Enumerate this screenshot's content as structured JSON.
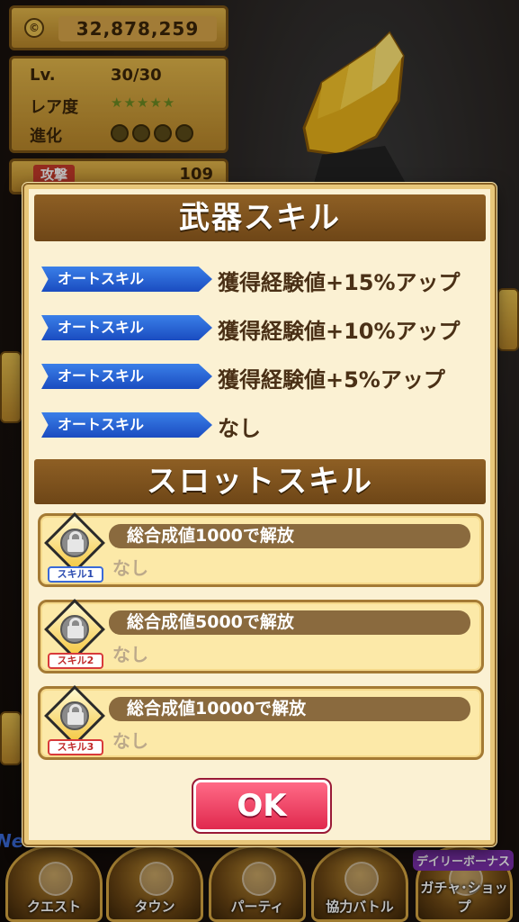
{
  "background": {
    "money": "32,878,259",
    "coin_symbol": "©",
    "stats": {
      "level_label": "Lv.",
      "level_value": "30/30",
      "rarity_label": "レア度",
      "rarity_stars": "★★★★★",
      "evolution_label": "進化"
    },
    "attack_label": "攻撃",
    "attack_value": "109"
  },
  "modal": {
    "weapon_skill_title": "武器スキル",
    "auto_skills": [
      {
        "tag": "オートスキル",
        "text": "獲得経験値+15%アップ"
      },
      {
        "tag": "オートスキル",
        "text": "獲得経験値+10%アップ"
      },
      {
        "tag": "オートスキル",
        "text": "獲得経験値+5%アップ"
      },
      {
        "tag": "オートスキル",
        "text": "なし"
      }
    ],
    "slot_skill_title": "スロットスキル",
    "slots": [
      {
        "label": "スキル1",
        "condition": "総合成値1000で解放",
        "value": "なし"
      },
      {
        "label": "スキル2",
        "condition": "総合成値5000で解放",
        "value": "なし"
      },
      {
        "label": "スキル3",
        "condition": "総合成値10000で解放",
        "value": "なし"
      }
    ],
    "ok_label": "OK"
  },
  "nav": {
    "items": [
      "クエスト",
      "タウン",
      "パーティ",
      "協力バトル",
      "ガチャ･ショップ"
    ],
    "daily_bonus": "デイリーボーナス",
    "new_tag": "New"
  },
  "colors": {
    "modal_bg": "#fbf1d3",
    "header_brown": "#7a5019",
    "skill_tag_blue": "#2a62d8",
    "ok_pink": "#f04468"
  }
}
